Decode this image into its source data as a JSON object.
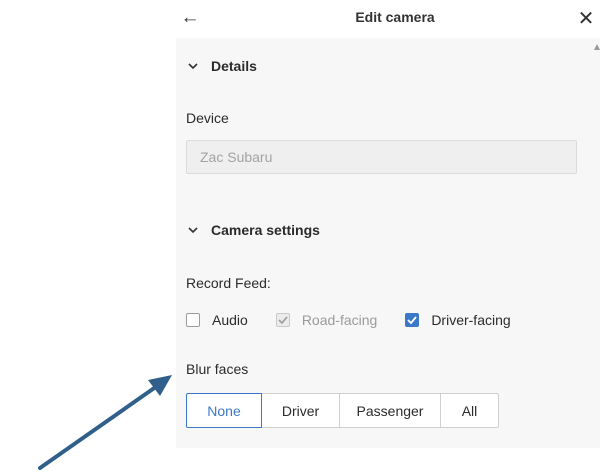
{
  "header": {
    "back_icon": "←",
    "title": "Edit camera",
    "close_icon": "✕"
  },
  "sections": {
    "details": {
      "chevron": "⌄",
      "label": "Details"
    },
    "camera_settings": {
      "chevron": "⌄",
      "label": "Camera settings"
    }
  },
  "device": {
    "label": "Device",
    "value": "Zac Subaru"
  },
  "record_feed": {
    "label": "Record Feed:",
    "options": [
      {
        "label": "Audio",
        "checked": false,
        "disabled": false
      },
      {
        "label": "Road-facing",
        "checked": true,
        "disabled": true
      },
      {
        "label": "Driver-facing",
        "checked": true,
        "disabled": false
      }
    ]
  },
  "blur_faces": {
    "label": "Blur faces",
    "options": [
      "None",
      "Driver",
      "Passenger",
      "All"
    ],
    "selected": "None"
  },
  "colors": {
    "accent": "#3b79c8",
    "annotation_arrow": "#2f5f8a"
  }
}
